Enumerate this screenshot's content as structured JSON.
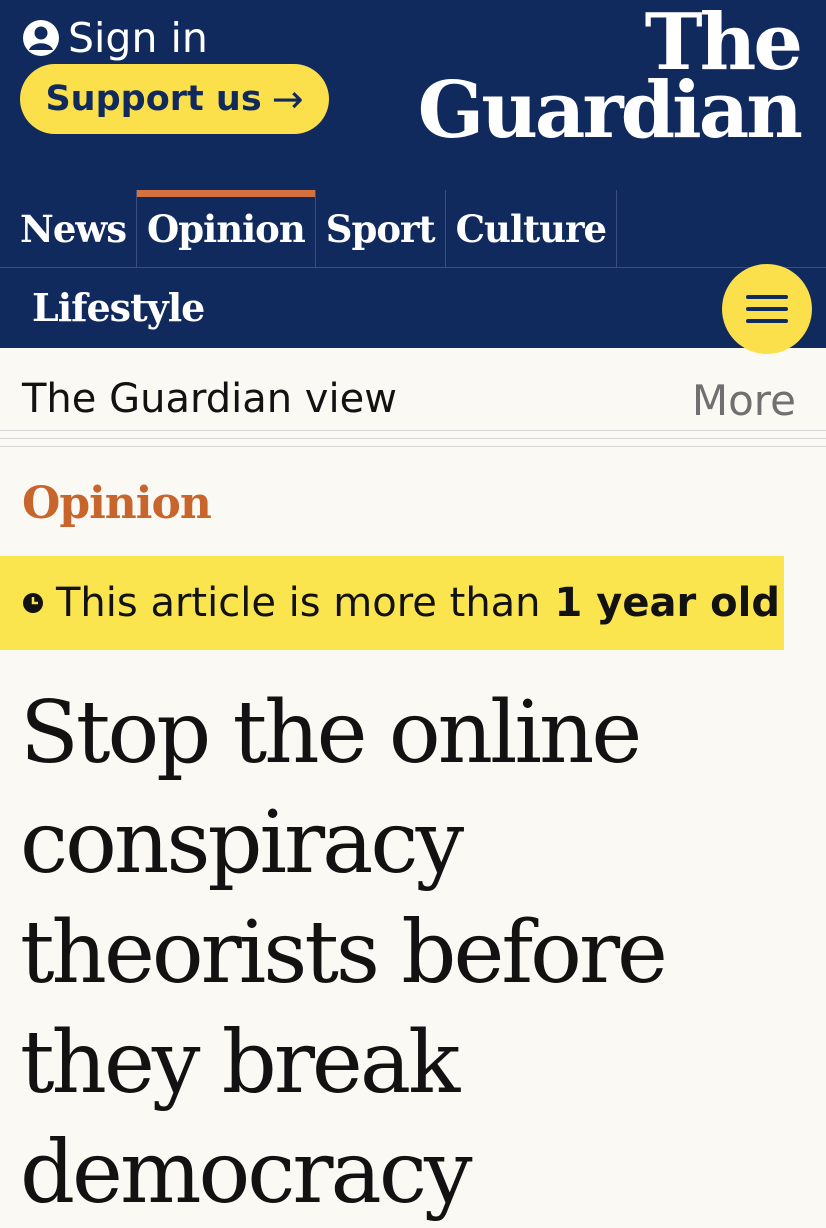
{
  "header": {
    "signin_label": "Sign in",
    "support_label": "Support us",
    "support_arrow": "→",
    "logo_line1": "The",
    "logo_line2": "Guardian",
    "bg_color": "#112a5e",
    "accent_yellow": "#fbe04b"
  },
  "nav": {
    "tabs": [
      {
        "label": "News"
      },
      {
        "label": "Opinion",
        "active": true
      },
      {
        "label": "Sport"
      },
      {
        "label": "Culture"
      }
    ],
    "secondary": "Lifestyle",
    "active_color": "#d4713e"
  },
  "subnav": {
    "section": "The Guardian view",
    "more": "More"
  },
  "article": {
    "kicker": "Opinion",
    "kicker_color": "#c7652c",
    "age_prefix": "This article is more than",
    "age_bold": "1 year old",
    "headline": "Stop the online conspiracy theorists before they break democracy"
  },
  "icons": {
    "user": "user-icon",
    "menu": "hamburger-menu-icon",
    "clock": "clock-icon"
  }
}
